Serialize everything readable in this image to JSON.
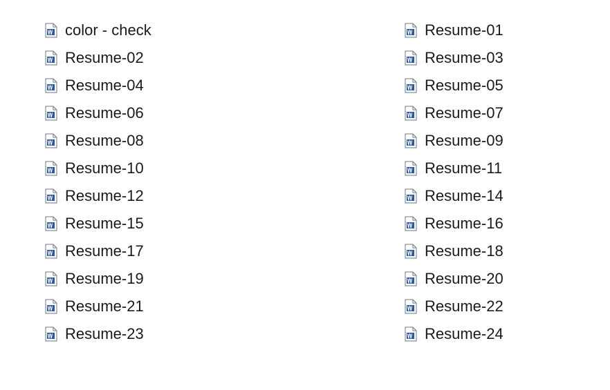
{
  "files": [
    {
      "name": "color - check"
    },
    {
      "name": "Resume-02"
    },
    {
      "name": "Resume-04"
    },
    {
      "name": "Resume-06"
    },
    {
      "name": "Resume-08"
    },
    {
      "name": "Resume-10"
    },
    {
      "name": "Resume-12"
    },
    {
      "name": "Resume-15"
    },
    {
      "name": "Resume-17"
    },
    {
      "name": "Resume-19"
    },
    {
      "name": "Resume-21"
    },
    {
      "name": "Resume-23"
    },
    {
      "name": "Resume-01"
    },
    {
      "name": "Resume-03"
    },
    {
      "name": "Resume-05"
    },
    {
      "name": "Resume-07"
    },
    {
      "name": "Resume-09"
    },
    {
      "name": "Resume-11"
    },
    {
      "name": "Resume-14"
    },
    {
      "name": "Resume-16"
    },
    {
      "name": "Resume-18"
    },
    {
      "name": "Resume-20"
    },
    {
      "name": "Resume-22"
    },
    {
      "name": "Resume-24"
    }
  ]
}
